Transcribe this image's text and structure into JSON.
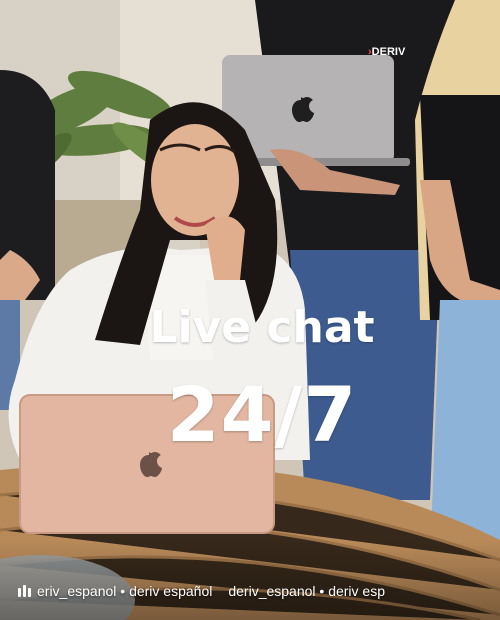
{
  "overlay": {
    "line1": "Live chat",
    "line2": "24/7"
  },
  "shirt_logo": "DERIV",
  "audio": {
    "icon": "audio-bars-icon",
    "track_1": "eriv_espanol • deriv español",
    "track_2": "deriv_espanol • deriv esp"
  },
  "colors": {
    "overlay_text": "#ffffff",
    "logo_accent": "#ff444f"
  }
}
